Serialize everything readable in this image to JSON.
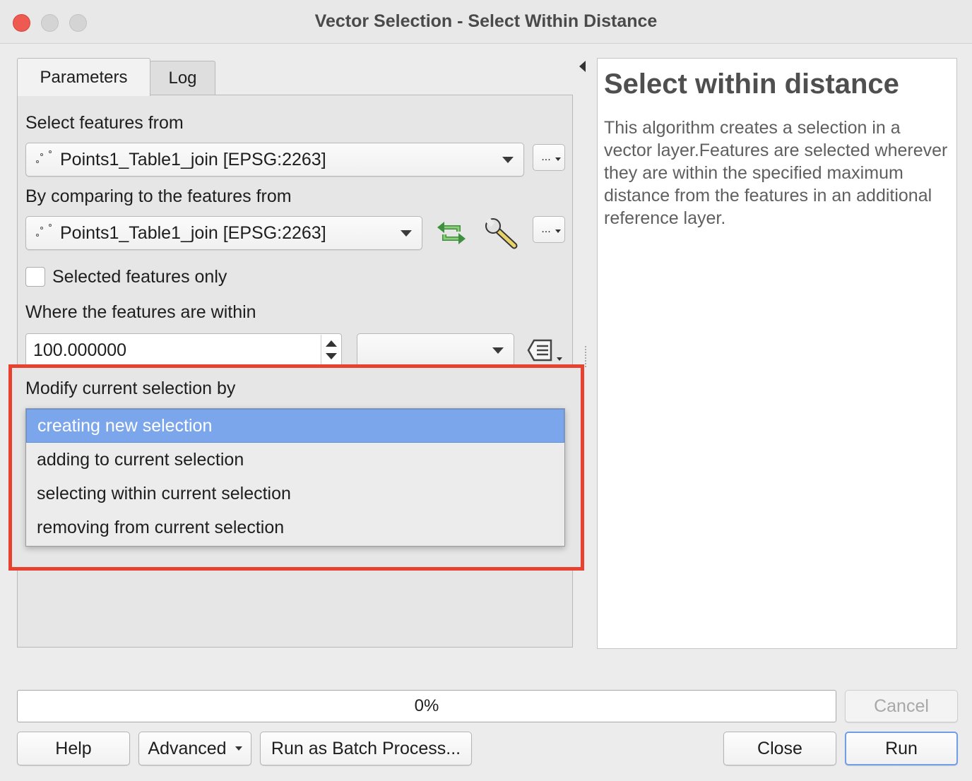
{
  "window": {
    "title": "Vector Selection - Select Within Distance"
  },
  "tabs": [
    {
      "label": "Parameters",
      "active": true
    },
    {
      "label": "Log",
      "active": false
    }
  ],
  "params": {
    "select_from_label": "Select features from",
    "select_from_value": "Points1_Table1_join [EPSG:2263]",
    "compare_label": "By comparing to the features from",
    "compare_value": "Points1_Table1_join [EPSG:2263]",
    "selected_only_label": "Selected features only",
    "selected_only_checked": false,
    "distance_label": "Where the features are within",
    "distance_value": "100.000000",
    "unit_value": "",
    "modify_label": "Modify current selection by",
    "browse_button": "..."
  },
  "modify_options": [
    {
      "label": "creating new selection",
      "selected": true
    },
    {
      "label": "adding to current selection",
      "selected": false
    },
    {
      "label": "selecting within current selection",
      "selected": false
    },
    {
      "label": "removing from current selection",
      "selected": false
    }
  ],
  "help": {
    "title": "Select within distance",
    "text": "This algorithm creates a selection in a vector layer.Features are selected wherever they are within the specified maximum distance from the features in an additional reference layer."
  },
  "progress": {
    "text": "0%",
    "value": 0
  },
  "buttons": {
    "cancel": "Cancel",
    "help": "Help",
    "advanced": "Advanced",
    "batch": "Run as Batch Process...",
    "close": "Close",
    "run": "Run"
  },
  "colors": {
    "highlight_border": "#e8412f",
    "selected_option": "#7ca6ec",
    "close_button": "#ee5a52"
  },
  "icons": {
    "iterate": "green-loop-icon",
    "settings": "wrench-icon",
    "data_defined": "data-defined-override-icon"
  }
}
